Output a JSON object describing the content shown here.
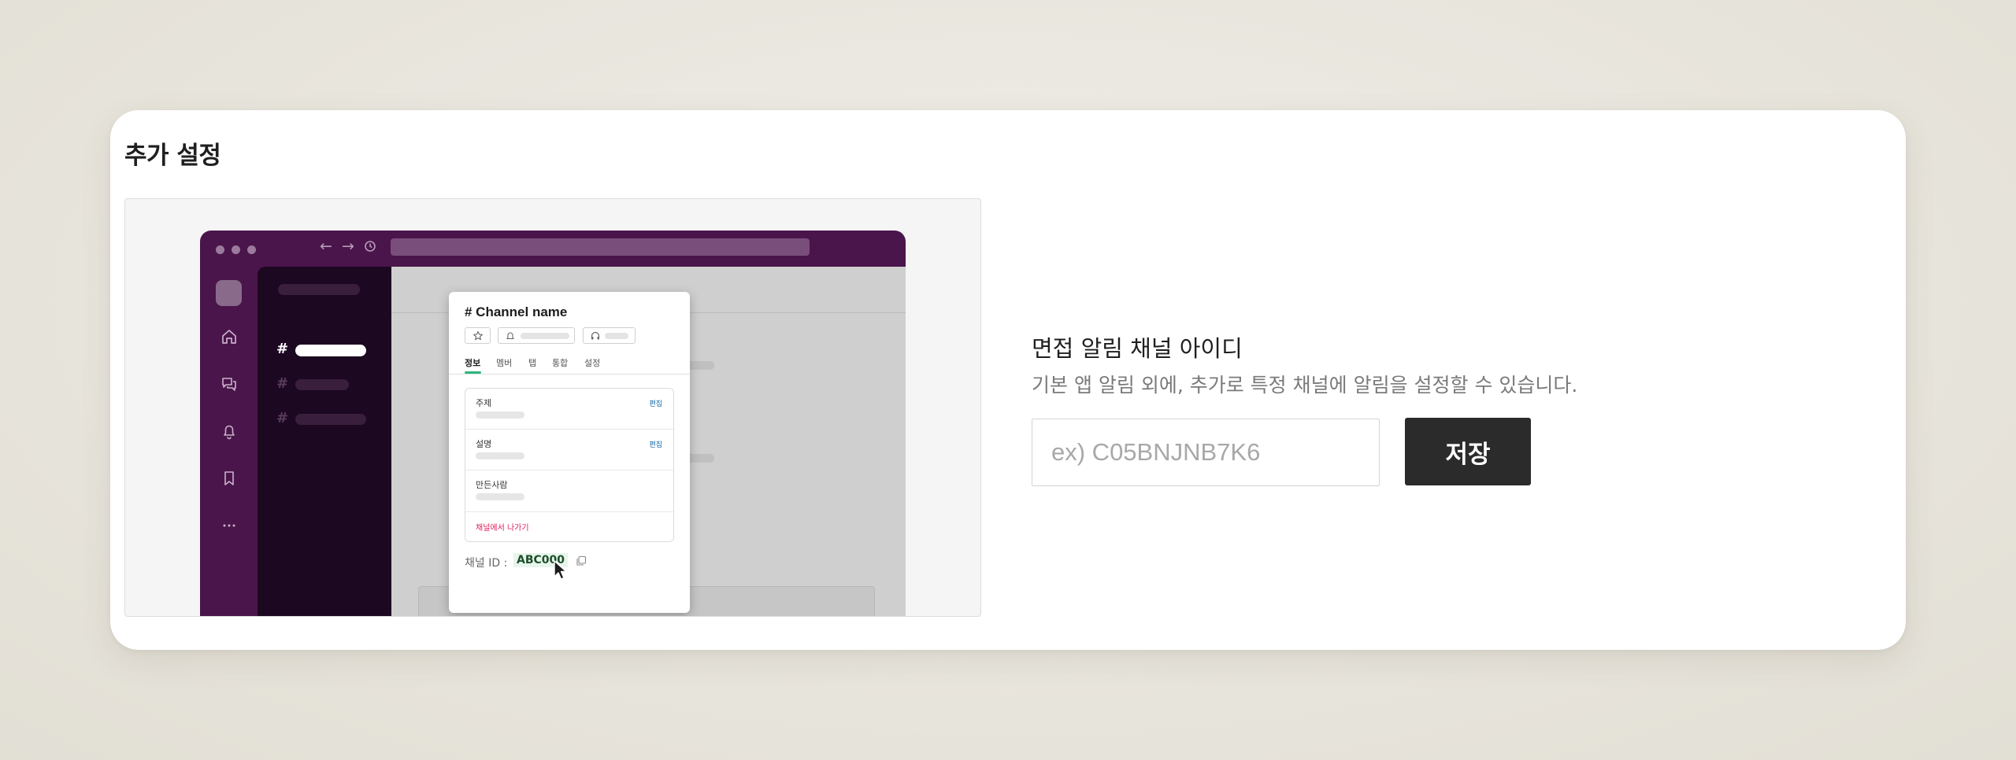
{
  "section": {
    "title": "추가 설정"
  },
  "preview": {
    "channel_title": "# Channel name",
    "tabs": [
      "정보",
      "멤버",
      "탭",
      "통합",
      "설정"
    ],
    "rows": [
      {
        "label": "주제",
        "edit": "편집"
      },
      {
        "label": "설명",
        "edit": "편집"
      },
      {
        "label": "만든사람",
        "edit": ""
      }
    ],
    "leave_label": "채널에서 나가기",
    "channel_id_label": "채널 ID :",
    "channel_id_value": "ABC000",
    "sidebar_hash": "#"
  },
  "form": {
    "title": "면접 알림 채널 아이디",
    "description": "기본 앱 알림 외에, 추가로 특정 채널에 알림을 설정할 수 있습니다.",
    "input_placeholder": "ex) C05BNJNB7K6",
    "input_value": "",
    "save_label": "저장"
  },
  "colors": {
    "slack_purple": "#4a154b",
    "button_bg": "#2b2b2b",
    "accent_green": "#2eb67d"
  }
}
